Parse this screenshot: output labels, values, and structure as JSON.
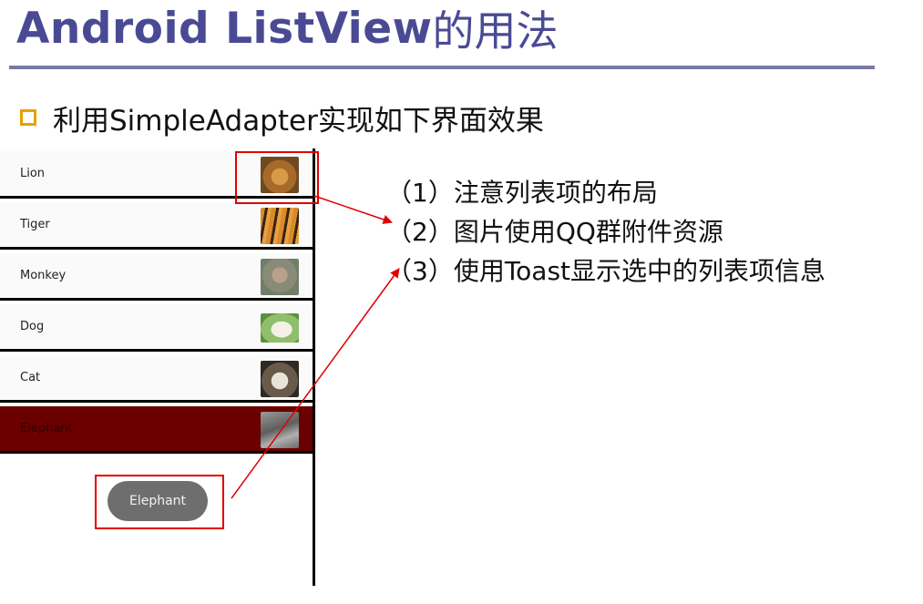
{
  "slide": {
    "title_en": "Android ListView",
    "title_cn": "的用法",
    "bullet": "利用SimpleAdapter实现如下界面效果"
  },
  "list": {
    "items": [
      {
        "label": "Lion",
        "icon": "lion-thumbnail-icon"
      },
      {
        "label": "Tiger",
        "icon": "tiger-thumbnail-icon"
      },
      {
        "label": "Monkey",
        "icon": "monkey-thumbnail-icon"
      },
      {
        "label": "Dog",
        "icon": "dog-thumbnail-icon"
      },
      {
        "label": "Cat",
        "icon": "cat-thumbnail-icon"
      },
      {
        "label": "Elephant",
        "icon": "elephant-thumbnail-icon",
        "selected": true
      }
    ],
    "toast": "Elephant"
  },
  "notes": [
    "（1）注意列表项的布局",
    "（2）图片使用QQ群附件资源",
    "（3）使用Toast显示选中的列表项信息"
  ],
  "colors": {
    "title": "#4a4a94",
    "rule": "#7a7aa6",
    "bullet": "#e6a100",
    "selected_row": "#6b0000",
    "toast_bg": "#6e6e6e",
    "annotation_red": "#e00000"
  }
}
